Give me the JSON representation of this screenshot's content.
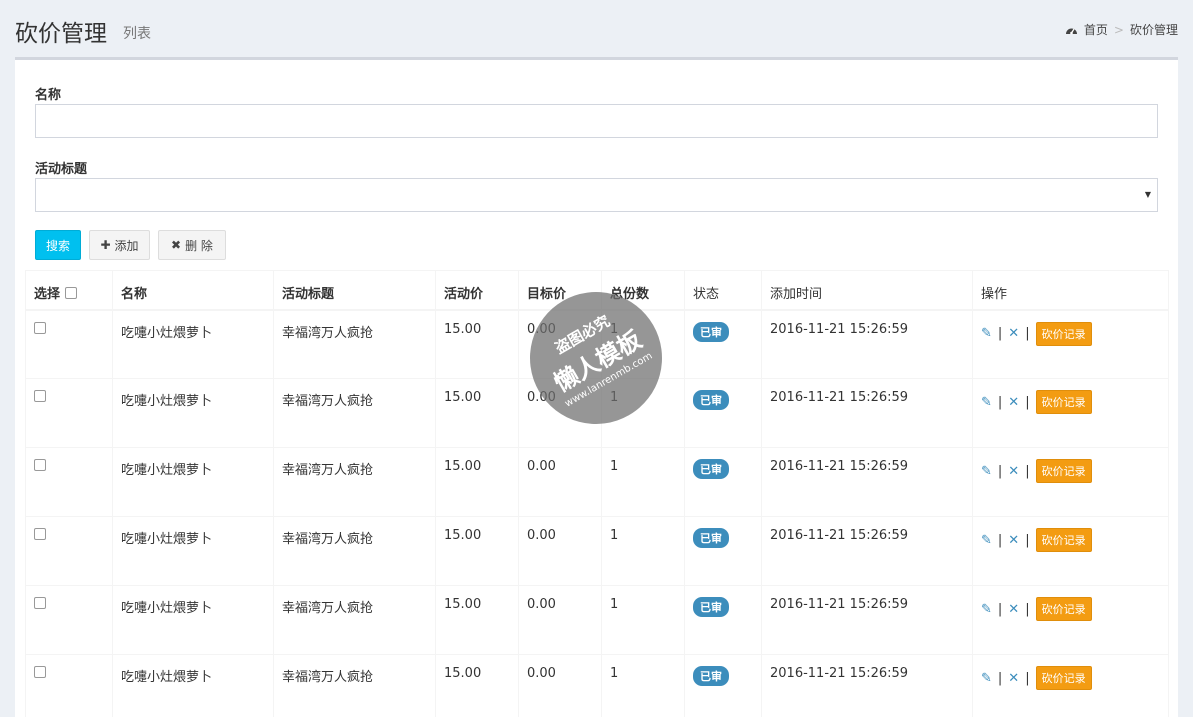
{
  "header": {
    "title": "砍价管理",
    "subtitle": "列表",
    "breadcrumb": {
      "icon": "dashboard-icon",
      "home": "首页",
      "separator": ">",
      "current": "砍价管理"
    }
  },
  "form": {
    "name_label": "名称",
    "name_value": "",
    "activity_label": "活动标题",
    "activity_selected": ""
  },
  "buttons": {
    "search": "搜索",
    "add": "添加",
    "delete": "删 除"
  },
  "table": {
    "columns": [
      "选择",
      "名称",
      "活动标题",
      "活动价",
      "目标价",
      "总份数",
      "状态",
      "添加时间",
      "操作"
    ],
    "rows": [
      {
        "name": "吃嚏小灶煨萝卜",
        "activity": "幸福湾万人疯抢",
        "price": "15.00",
        "target": "0.00",
        "count": "1",
        "status": "已审",
        "time": "2016-11-21 15:26:59",
        "action": "砍价记录"
      },
      {
        "name": "吃嚏小灶煨萝卜",
        "activity": "幸福湾万人疯抢",
        "price": "15.00",
        "target": "0.00",
        "count": "1",
        "status": "已审",
        "time": "2016-11-21 15:26:59",
        "action": "砍价记录"
      },
      {
        "name": "吃嚏小灶煨萝卜",
        "activity": "幸福湾万人疯抢",
        "price": "15.00",
        "target": "0.00",
        "count": "1",
        "status": "已审",
        "time": "2016-11-21 15:26:59",
        "action": "砍价记录"
      },
      {
        "name": "吃嚏小灶煨萝卜",
        "activity": "幸福湾万人疯抢",
        "price": "15.00",
        "target": "0.00",
        "count": "1",
        "status": "已审",
        "time": "2016-11-21 15:26:59",
        "action": "砍价记录"
      },
      {
        "name": "吃嚏小灶煨萝卜",
        "activity": "幸福湾万人疯抢",
        "price": "15.00",
        "target": "0.00",
        "count": "1",
        "status": "已审",
        "time": "2016-11-21 15:26:59",
        "action": "砍价记录"
      },
      {
        "name": "吃嚏小灶煨萝卜",
        "activity": "幸福湾万人疯抢",
        "price": "15.00",
        "target": "0.00",
        "count": "1",
        "status": "已审",
        "time": "2016-11-21 15:26:59",
        "action": "砍价记录"
      }
    ]
  },
  "watermark": {
    "line1": "盗图必究",
    "line2": "懒人模板",
    "line3": "www.lanrenmb.com"
  },
  "colors": {
    "accent": "#00c0ef",
    "badge": "#3c8dbc",
    "record_button": "#f39c12"
  }
}
